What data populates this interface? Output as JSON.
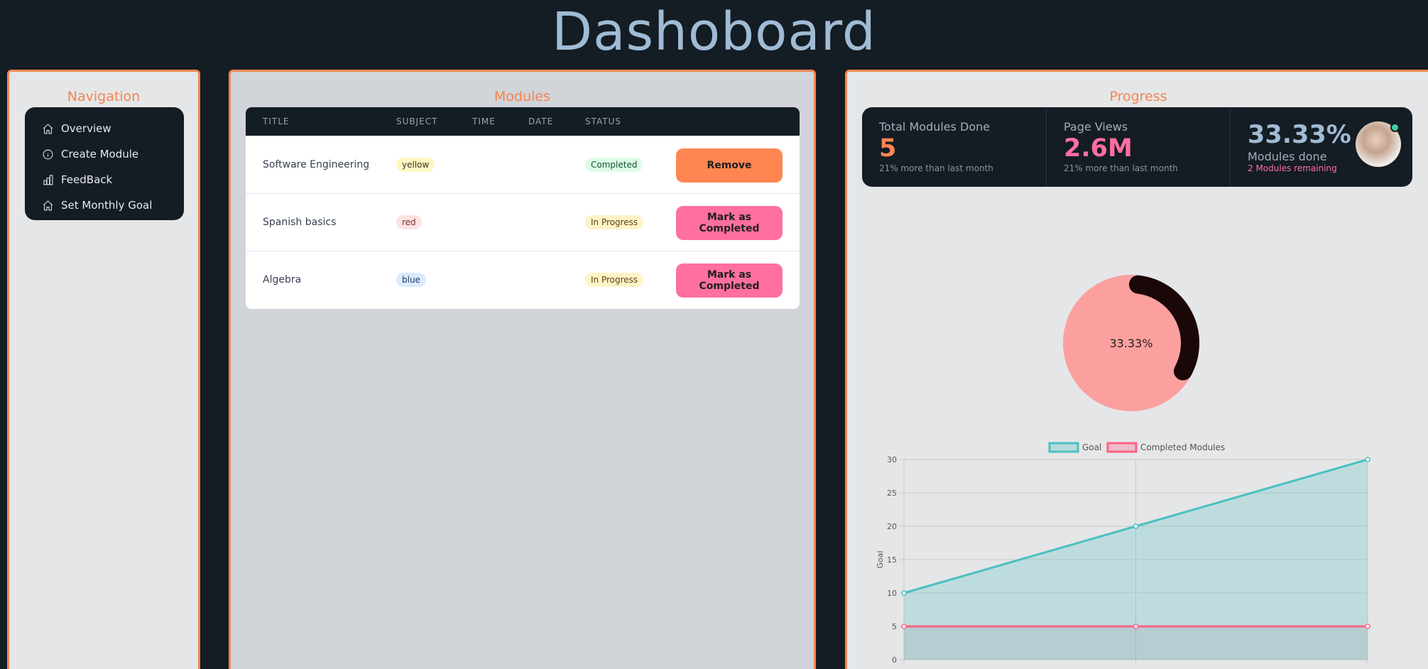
{
  "page": {
    "title": "Dashoboard"
  },
  "navigation": {
    "title": "Navigation",
    "items": [
      {
        "label": "Overview",
        "icon": "home-icon"
      },
      {
        "label": "Create Module",
        "icon": "info-icon"
      },
      {
        "label": "FeedBack",
        "icon": "bar-chart-icon"
      },
      {
        "label": "Set Monthly Goal",
        "icon": "home-icon"
      }
    ]
  },
  "modules": {
    "title": "Modules",
    "columns": [
      "TITLE",
      "SUBJECT",
      "TIME",
      "DATE",
      "STATUS"
    ],
    "rows": [
      {
        "title": "Software Engineering",
        "subject": "yellow",
        "time": "",
        "date": "",
        "status": "Completed",
        "action": "Remove"
      },
      {
        "title": "Spanish basics",
        "subject": "red",
        "time": "",
        "date": "",
        "status": "In Progress",
        "action": "Mark as Completed"
      },
      {
        "title": "Algebra",
        "subject": "blue",
        "time": "",
        "date": "",
        "status": "In Progress",
        "action": "Mark as Completed"
      }
    ]
  },
  "progress": {
    "title": "Progress",
    "stats": [
      {
        "title": "Total Modules Done",
        "value": "5",
        "desc": "21% more than last month",
        "color": "#ff8650"
      },
      {
        "title": "Page Views",
        "value": "2.6M",
        "desc": "21% more than last month",
        "color": "#ff6f9f"
      },
      {
        "title": "Modules done",
        "value": "33.33%",
        "desc": "2 Modules remaining",
        "color": "#a0bbd4"
      }
    ]
  },
  "chart_data": [
    {
      "type": "pie",
      "center_label": "33.33%",
      "values": [
        33.33,
        66.67
      ],
      "colors": [
        "#1a0707",
        "#fba09e"
      ]
    },
    {
      "type": "area",
      "legend": [
        "Goal",
        "Completed Modules"
      ],
      "legend_position": "top-center",
      "ylabel": "Goal",
      "ylim": [
        0,
        30
      ],
      "yticks": [
        0,
        5,
        10,
        15,
        20,
        25,
        30
      ],
      "grid": true,
      "series": [
        {
          "name": "Goal",
          "values": [
            10,
            20,
            30
          ],
          "color": "#4bc0c0"
        },
        {
          "name": "Completed Modules",
          "values": [
            5,
            5,
            5
          ],
          "color": "#ff6384"
        }
      ]
    }
  ]
}
